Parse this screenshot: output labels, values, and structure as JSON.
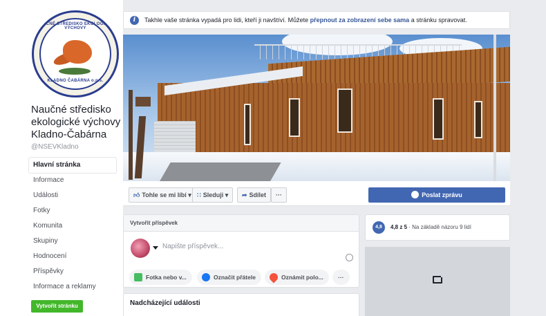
{
  "page": {
    "name": "Naučné středisko ekologické výchovy Kladno-Čabárna",
    "handle": "@NSEVKladno",
    "logo_text_top": "NAUČNÉ STŘEDISKO EKOLOGICKÉ VÝCHOVY",
    "logo_text_bottom": "KLADNO ČABÁRNA o.p.s."
  },
  "notice": {
    "text_before": "Takhle vaše stránka vypadá pro lidi, kteří ji navštíví. Můžete",
    "link": "přepnout za zobrazení sebe sama",
    "text_after": "a stránku spravovat."
  },
  "nav": {
    "items": [
      "Hlavní stránka",
      "Informace",
      "Události",
      "Fotky",
      "Komunita",
      "Skupiny",
      "Hodnocení",
      "Příspěvky",
      "Informace a reklamy"
    ],
    "active": "Hlavní stránka"
  },
  "create_page_label": "Vytvořit stránku",
  "actions": {
    "like": "Tohle se mi líbí",
    "follow": "Sleduji",
    "share": "Sdílet",
    "more": "···",
    "message": "Poslat zprávu"
  },
  "composer": {
    "title": "Vytvořit příspěvek",
    "placeholder": "Napište příspěvek...",
    "chips": [
      "Fotka nebo v...",
      "Označit přátele",
      "Oznámit polo...",
      "···"
    ]
  },
  "events": {
    "title": "Nadcházející události"
  },
  "rating": {
    "score": "4,8",
    "text_bold": "4,8 z 5",
    "text": "· Na základě názoru 9 lidí"
  },
  "colors": {
    "brand": "#4267b2",
    "create_button": "#42b72a",
    "background": "#e9ebee"
  }
}
